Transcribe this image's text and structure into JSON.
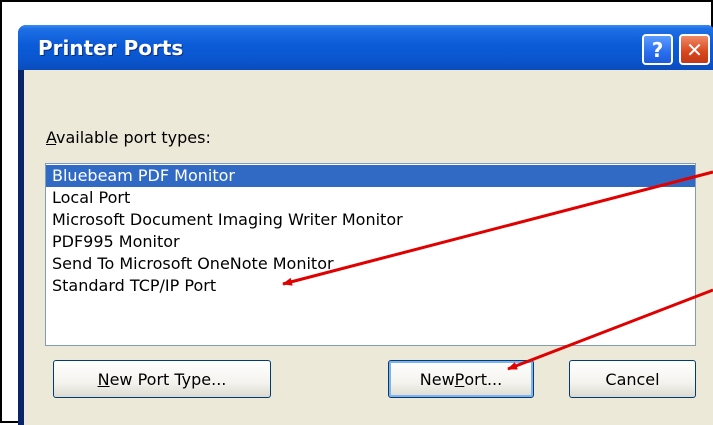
{
  "dialog": {
    "title": "Printer Ports",
    "help_button": "?",
    "close_button": "✕"
  },
  "port_types": {
    "label_mnemonic": "A",
    "label_rest": "vailable port types:",
    "items": [
      "Bluebeam PDF Monitor",
      "Local Port",
      "Microsoft Document Imaging Writer Monitor",
      "PDF995 Monitor",
      "Send To Microsoft OneNote Monitor",
      "Standard TCP/IP Port"
    ],
    "selected_index": 0
  },
  "buttons": {
    "new_port_type_mnemonic": "N",
    "new_port_type_rest": "ew Port Type...",
    "new_port_pre": "New ",
    "new_port_mnemonic": "P",
    "new_port_rest": "ort...",
    "cancel": "Cancel"
  },
  "colors": {
    "annotation_arrow": "#e00000",
    "selection": "#316ac5",
    "titlebar": "#0b5bd8"
  }
}
